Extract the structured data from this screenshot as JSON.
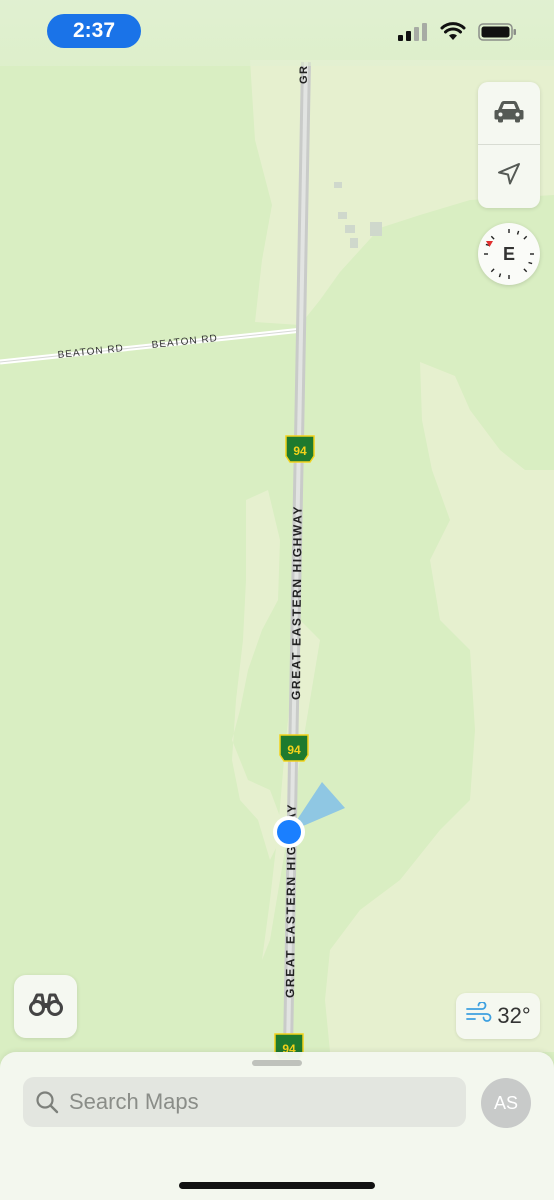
{
  "status_bar": {
    "time": "2:37"
  },
  "map": {
    "roads": [
      {
        "name": "BEATON RD",
        "type": "local"
      },
      {
        "name": "GREAT EASTERN HIGHWAY",
        "type": "highway"
      }
    ],
    "road_labels": {
      "beaton_1": "BEATON RD",
      "beaton_2": "BEATON RD",
      "highway_top": "GR",
      "highway_1": "GREAT EASTERN HIGHWAY",
      "highway_2": "GREAT EASTERN HIGHWAY"
    },
    "route_shields": [
      "94",
      "94",
      "94"
    ],
    "colors": {
      "land": "#d9eec2",
      "land_pale": "#e6f0cf",
      "road": "#c9cbc9",
      "shield": "#1e7a2e",
      "shield_text": "#f3d21b",
      "user_location": "#1a7fff"
    }
  },
  "controls": {
    "driving_mode_icon": "car-icon",
    "location_icon": "location-arrow-icon",
    "compass_heading": "E",
    "look_around_icon": "binoculars-icon"
  },
  "weather": {
    "icon": "wind-icon",
    "temperature": "32°"
  },
  "sheet": {
    "search_placeholder": "Search Maps",
    "avatar_initials": "AS"
  }
}
